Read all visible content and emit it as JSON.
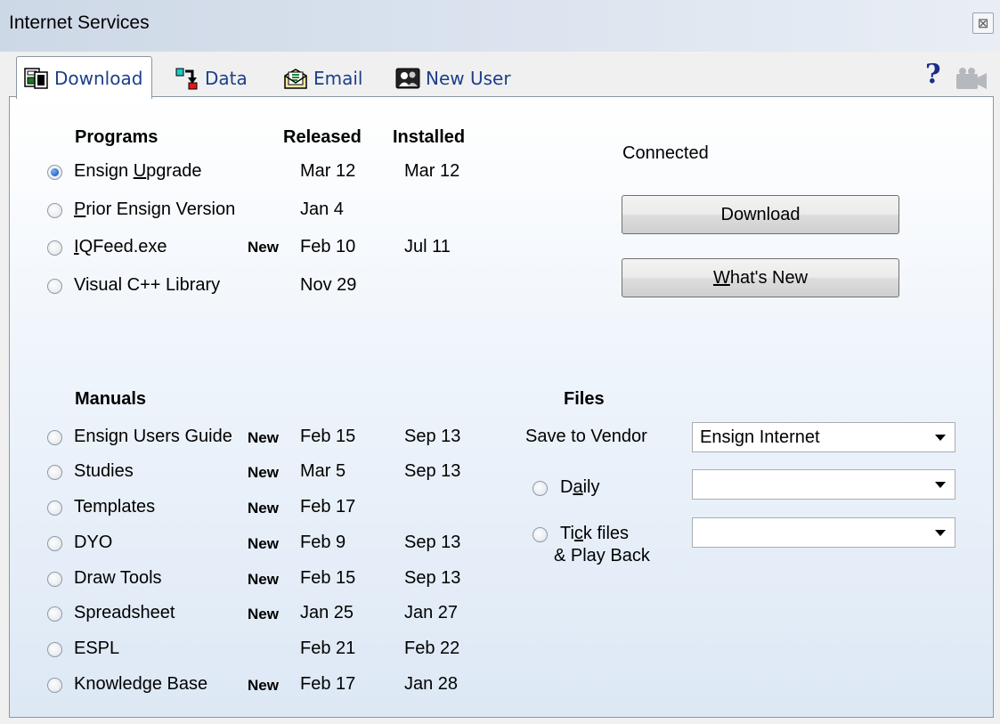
{
  "window": {
    "title": "Internet Services",
    "close_glyph": "⊠"
  },
  "tabs": [
    {
      "label": "Download",
      "icon": "download-icon",
      "active": true
    },
    {
      "label": "Data",
      "icon": "data-icon"
    },
    {
      "label": "Email",
      "icon": "email-icon"
    },
    {
      "label": "New User",
      "icon": "new-user-icon"
    }
  ],
  "toolbar": {
    "help_glyph": "?",
    "camera_icon": "camera-icon"
  },
  "programs": {
    "header": "Programs",
    "released_header": "Released",
    "installed_header": "Installed",
    "items": [
      {
        "pre": "Ensign ",
        "u": "U",
        "post": "pgrade",
        "new": "",
        "released": "Mar 12",
        "installed": "Mar 12",
        "selected": true
      },
      {
        "pre": "",
        "u": "P",
        "post": "rior Ensign Version",
        "new": "",
        "released": "Jan 4",
        "installed": ""
      },
      {
        "pre": "",
        "u": "I",
        "post": "QFeed.exe",
        "new": "New",
        "released": "Feb 10",
        "installed": "Jul 11"
      },
      {
        "pre": "Visual C++ Library",
        "u": "",
        "post": "",
        "new": "",
        "released": "Nov 29",
        "installed": ""
      }
    ]
  },
  "status": {
    "connection": "Connected"
  },
  "buttons": {
    "download": "Download",
    "whats_new_u": "W",
    "whats_new_rest": "hat's New"
  },
  "manuals": {
    "header": "Manuals",
    "items": [
      {
        "label": "Ensign Users Guide",
        "new": "New",
        "released": "Feb 15",
        "installed": "Sep 13"
      },
      {
        "label": "Studies",
        "new": "New",
        "released": "Mar 5",
        "installed": "Sep 13"
      },
      {
        "label": "Templates",
        "new": "New",
        "released": "Feb 17",
        "installed": ""
      },
      {
        "label": "DYO",
        "new": "New",
        "released": "Feb 9",
        "installed": "Sep 13"
      },
      {
        "label": "Draw Tools",
        "new": "New",
        "released": "Feb 15",
        "installed": "Sep 13"
      },
      {
        "label": "Spreadsheet",
        "new": "New",
        "released": "Jan 25",
        "installed": "Jan 27"
      },
      {
        "label": "ESPL",
        "new": "",
        "released": "Feb 21",
        "installed": "Feb 22"
      },
      {
        "label": "Knowledge Base",
        "new": "New",
        "released": "Feb 17",
        "installed": "Jan 28"
      }
    ]
  },
  "files": {
    "header": "Files",
    "save_to_vendor_label": "Save to Vendor",
    "save_to_vendor_value": "Ensign Internet",
    "daily_pre": "D",
    "daily_u": "a",
    "daily_post": "ily",
    "daily_value": "",
    "tick_pre": "Ti",
    "tick_u": "c",
    "tick_post": "k files",
    "tick_line2": "& Play Back",
    "tick_value": ""
  }
}
